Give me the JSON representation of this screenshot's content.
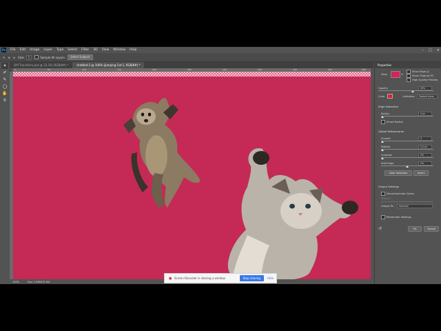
{
  "app": {
    "name": "Adobe Photoshop",
    "logo": "Ps"
  },
  "menu": [
    "File",
    "Edit",
    "Image",
    "Layer",
    "Type",
    "Select",
    "Filter",
    "3D",
    "View",
    "Window",
    "Help"
  ],
  "options": {
    "size_label": "Size:",
    "size_value": "5",
    "sample_all_layers": "Sample All Layers",
    "select_subject": "Select Subject"
  },
  "tabs": [
    {
      "label": "Diff Transform.psd @ 33.3% (RGB/8#) *",
      "active": false
    },
    {
      "label": "Untitled-2 @ 100% (Jumping Cat 1, RGB/8#) *",
      "active": true
    }
  ],
  "ruler": [
    "0",
    "50",
    "100",
    "150",
    "200",
    "250",
    "300",
    "350",
    "400",
    "450",
    "500"
  ],
  "status": {
    "zoom": "100%",
    "doc": "Doc: 2.69M/15.9M"
  },
  "share_bar": {
    "message": "Screen Recorder is sharing a window.",
    "stop": "Stop sharing",
    "hide": "Hide"
  },
  "panel": {
    "title": "Properties",
    "view_label": "View:",
    "show_edge": "Show Edge (J)",
    "show_original": "Show Original (P)",
    "high_quality": "High Quality Preview",
    "opacity_label": "Opacity",
    "opacity_value": "50%",
    "color_label": "Color",
    "indicates_label": "Indicates:",
    "indicates_value": "Masked Areas",
    "edge_detection": "Edge Detection",
    "radius_label": "Radius",
    "radius_value": "0 px",
    "smart_radius": "Smart Radius",
    "global_refinements": "Global Refinements",
    "smooth_label": "Smooth",
    "smooth_value": "0",
    "feather_label": "Feather",
    "feather_value": "0.0 px",
    "contrast_label": "Contrast",
    "contrast_value": "0%",
    "shift_edge_label": "Shift Edge",
    "shift_edge_value": "0%",
    "clear_selection": "Clear Selection",
    "invert": "Invert",
    "output_settings": "Output Settings",
    "decontaminate": "Decontaminate Colors",
    "amount_label": "Amount",
    "output_to_label": "Output To:",
    "output_to_value": "Selection",
    "remember": "Remember Settings",
    "ok": "OK",
    "cancel": "Cancel"
  },
  "colors": {
    "canvas": "#c42a55",
    "overlay_swatch": "#d6245a",
    "accent": "#3b78e7"
  }
}
